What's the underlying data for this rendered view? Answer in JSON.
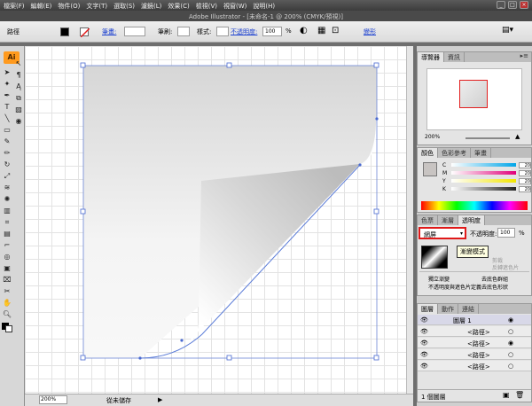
{
  "window": {
    "title": "Adobe Illustrator - [未命名-1 @ 200% (CMYK/預視)]",
    "menus": [
      "檔案(F)",
      "編輯(E)",
      "物件(O)",
      "文字(T)",
      "選取(S)",
      "濾鏡(L)",
      "效果(C)",
      "檢視(V)",
      "視窗(W)",
      "說明(H)"
    ]
  },
  "control_bar": {
    "selection_label": "路徑",
    "stroke_label": "筆畫:",
    "brush_label": "筆刷:",
    "style_label": "樣式:",
    "opacity_label": "不透明度:",
    "opacity_value": "100",
    "opacity_unit": "%",
    "transform_label": "變形",
    "fill_color": "#000000"
  },
  "document": {
    "zoom": "200%",
    "status": "從未儲存"
  },
  "navigator": {
    "tabs": [
      "導覽器",
      "資訊"
    ],
    "zoom": "200%"
  },
  "color_panel": {
    "tabs": [
      "顏色",
      "色彩參考",
      "筆畫"
    ],
    "channels": [
      {
        "label": "C",
        "value": "20",
        "color": "#00a5e8"
      },
      {
        "label": "M",
        "value": "20",
        "color": "#e0007a"
      },
      {
        "label": "Y",
        "value": "20",
        "color": "#f2e600"
      },
      {
        "label": "K",
        "value": "20",
        "color": "#222222"
      }
    ],
    "unit": "%"
  },
  "transparency_panel": {
    "tabs": [
      "色票",
      "漸層",
      "透明度"
    ],
    "blend_mode": "網屏",
    "opacity_label": "不透明度:",
    "opacity_value": "100",
    "tooltip": "漸變模式",
    "clip_label": "剪裁",
    "invert_mask_label": "反轉遮色片",
    "isolate_blending": "獨立漸變",
    "knockout_group": "去底色群組",
    "opacity_mask_shape": "不透明度與遮色片定義去底色形狀"
  },
  "layers_panel": {
    "tabs": [
      "圖層",
      "動作",
      "連結"
    ],
    "layers": [
      {
        "name": "圖層 1"
      },
      {
        "name": "<路徑>"
      },
      {
        "name": "<路徑>"
      },
      {
        "name": "<路徑>"
      },
      {
        "name": "<路徑>"
      }
    ],
    "footer": "1 個圖層"
  }
}
